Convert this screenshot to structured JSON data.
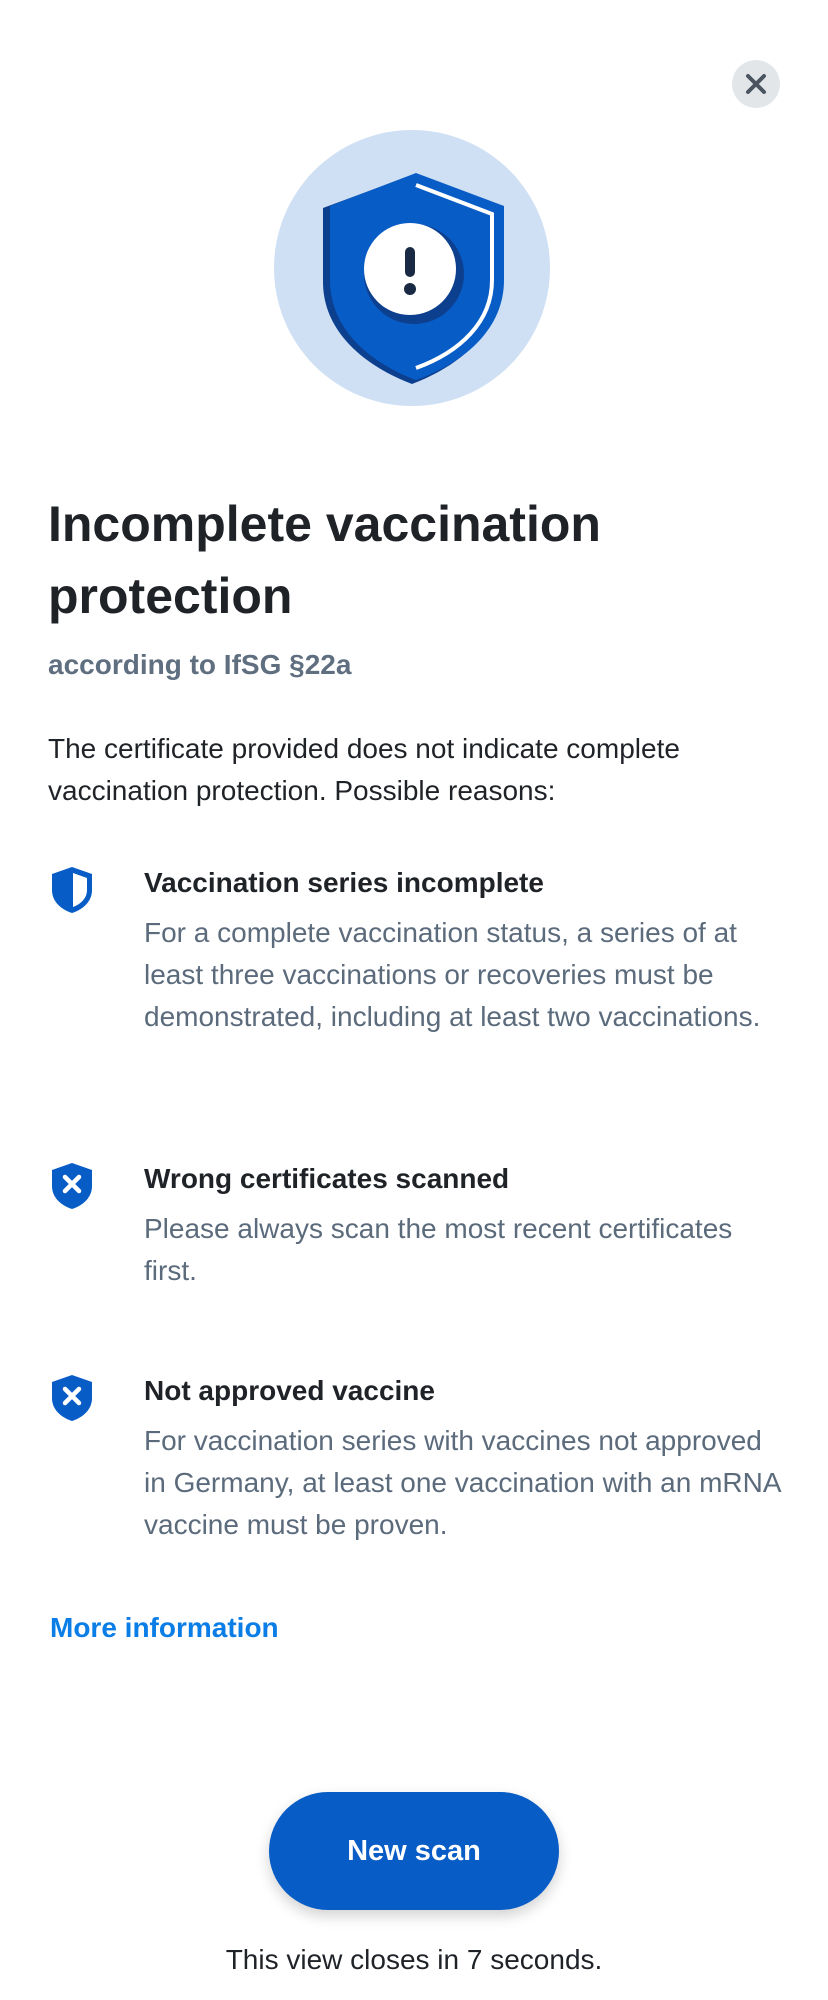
{
  "close_label": "Close",
  "hero_icon": "shield-exclamation-icon",
  "title": "Incomplete vaccination protection",
  "subtitle": "according to IfSG §22a",
  "intro": "The certificate provided does not indicate complete vaccination protection. Possible reasons:",
  "reasons": [
    {
      "icon": "shield-half-icon",
      "title": "Vaccination series incomplete",
      "description": "For a complete vaccination status, a series of at least three vaccinations or recoveries must be demonstrated, including at least two vaccinations."
    },
    {
      "icon": "shield-x-icon",
      "title": "Wrong certificates scanned",
      "description": "Please always scan the most recent certificates first."
    },
    {
      "icon": "shield-x-icon",
      "title": "Not approved vaccine",
      "description": "For vaccination series with vaccines not approved in Germany, at least one vaccination with an mRNA vaccine must be proven."
    }
  ],
  "more_info": "More information",
  "new_scan": "New scan",
  "countdown": "This view closes in 7 seconds.",
  "colors": {
    "primary": "#075cc6",
    "link": "#0a7ee6",
    "hero_circle": "#cfe0f5",
    "muted_text": "#5b6b7c"
  }
}
